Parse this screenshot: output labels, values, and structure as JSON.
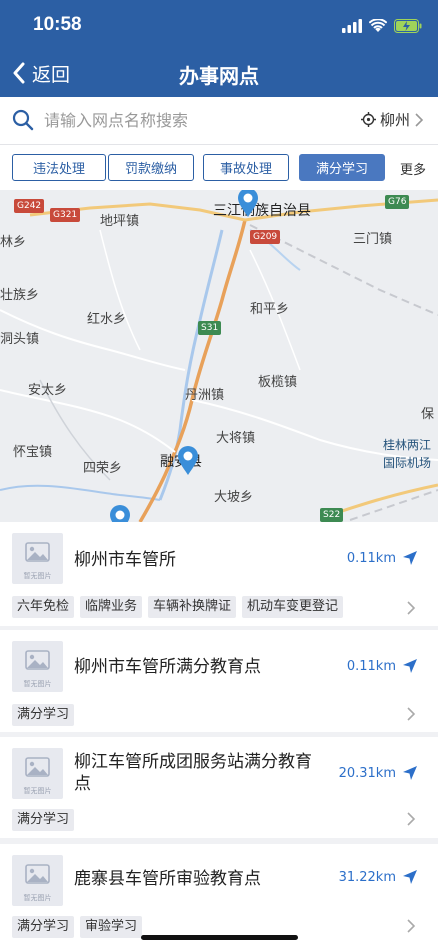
{
  "status_bar": {
    "time": "10:58"
  },
  "nav": {
    "back_label": "返回",
    "title": "办事网点"
  },
  "search": {
    "placeholder": "请输入网点名称搜索",
    "city": "柳州"
  },
  "filters": {
    "chips": [
      "违法处理",
      "罚款缴纳",
      "事故处理",
      "满分学习"
    ],
    "active_index": 3,
    "more_label": "更多"
  },
  "map": {
    "labels": [
      "地坪镇",
      "三江侗族自治县",
      "三门镇",
      "林乡",
      "红水乡",
      "和平乡",
      "壮族乡",
      "洞头镇",
      "丹洲镇",
      "板榄镇",
      "安太乡",
      "大将镇",
      "怀宝镇",
      "四荣乡",
      "融安县",
      "大坡乡",
      "桂林两江",
      "国际机场",
      "保"
    ],
    "road_badges": [
      "G242",
      "G321",
      "G209",
      "G76",
      "S31",
      "S22"
    ]
  },
  "list": {
    "thumb_caption": "暂无图片",
    "items": [
      {
        "name": "柳州市车管所",
        "distance": "0.11km",
        "tags": [
          "六年免检",
          "临牌业务",
          "车辆补换牌证",
          "机动车变更登记"
        ]
      },
      {
        "name": "柳州市车管所满分教育点",
        "distance": "0.11km",
        "tags": [
          "满分学习"
        ]
      },
      {
        "name": "柳江车管所成团服务站满分教育点",
        "distance": "20.31km",
        "tags": [
          "满分学习"
        ]
      },
      {
        "name": "鹿寨县车管所审验教育点",
        "distance": "31.22km",
        "tags": [
          "满分学习",
          "审验学习"
        ]
      }
    ]
  },
  "colors": {
    "brand": "#2c5fa4",
    "chip_active": "#4a78c0",
    "distance": "#2c6fc9",
    "pin": "#3a8ed9"
  }
}
